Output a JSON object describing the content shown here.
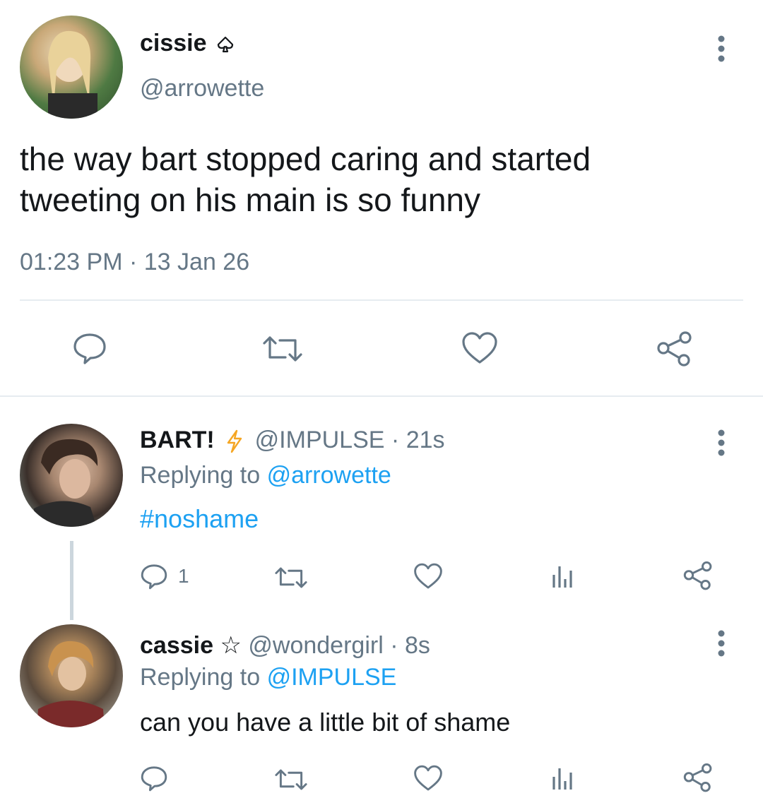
{
  "main_tweet": {
    "display_name": "cissie",
    "name_badge": "spade",
    "handle": "@arrowette",
    "text_line1": "the way bart stopped caring and started",
    "text_line2": "tweeting on his main is so funny",
    "time": "01:23 PM",
    "separator": "·",
    "date": "13 Jan 26"
  },
  "replies": [
    {
      "display_name": "BART!",
      "name_badge": "lightning",
      "handle": "@IMPULSE",
      "meta_sep": "·",
      "age": "21s",
      "replying_prefix": "Replying to",
      "replying_to": "@arrowette",
      "text": "#noshame",
      "reply_count": "1"
    },
    {
      "display_name": "cassie",
      "name_badge": "☆",
      "handle": "@wondergirl",
      "meta_sep": "·",
      "age": "8s",
      "replying_prefix": "Replying to",
      "replying_to": "@IMPULSE",
      "text": "can you have a little bit of shame",
      "reply_count": ""
    }
  ],
  "colors": {
    "text": "#14171a",
    "secondary": "#657786",
    "link": "#1da1f2",
    "lightning": "#f5a623",
    "divider": "#e6ecf0"
  },
  "icons": [
    "reply-icon",
    "retweet-icon",
    "like-icon",
    "share-icon",
    "analytics-icon",
    "more-icon",
    "spade-icon",
    "lightning-icon"
  ]
}
